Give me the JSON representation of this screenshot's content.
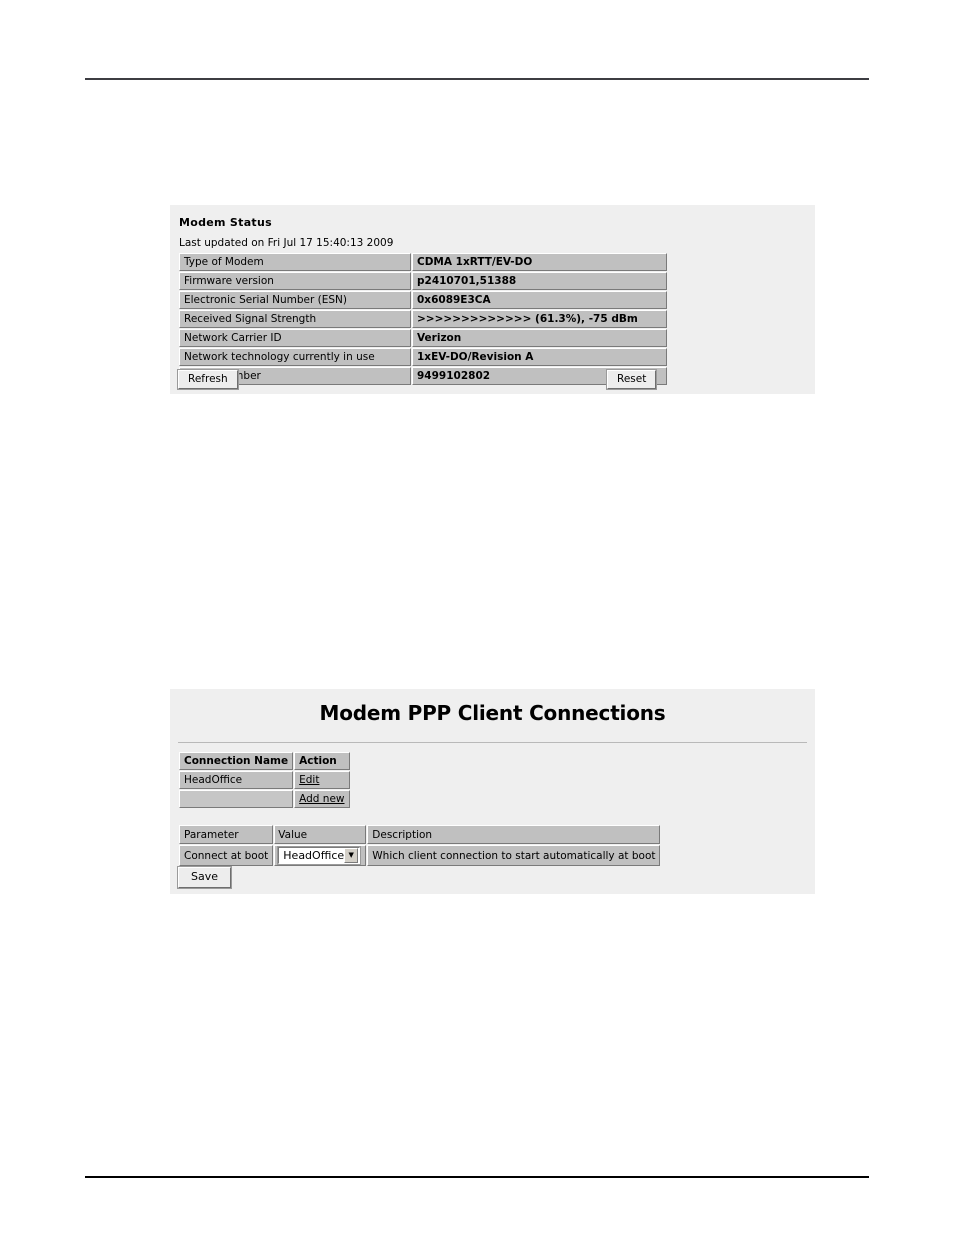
{
  "page": {
    "background": "#ffffff",
    "panel_background": "#efefef",
    "table_cell_background": "#c0c0c0",
    "rule_color": "#3d3d42"
  },
  "modem_status": {
    "heading": "Modem Status",
    "last_updated": "Last updated on Fri Jul 17 15:40:13 2009",
    "rows": [
      {
        "label": "Type of Modem",
        "value": "CDMA 1xRTT/EV-DO"
      },
      {
        "label": "Firmware version",
        "value": "p2410701,51388"
      },
      {
        "label": "Electronic Serial Number (ESN)",
        "value": "0x6089E3CA"
      },
      {
        "label": "Received Signal Strength",
        "value": ">>>>>>>>>>>>> (61.3%), -75 dBm"
      },
      {
        "label": "Network Carrier ID",
        "value": "Verizon"
      },
      {
        "label": "Network technology currently in use",
        "value": "1xEV-DO/Revision A"
      },
      {
        "label": "Phone number",
        "value": "9499102802"
      }
    ],
    "refresh_label": "Refresh",
    "reset_label": "Reset"
  },
  "ppp": {
    "title": "Modem PPP Client Connections",
    "connections_table": {
      "headers": [
        "Connection Name",
        "Action"
      ],
      "rows": [
        {
          "name": "HeadOffice",
          "action": "Edit"
        },
        {
          "name": "",
          "action": "Add new"
        }
      ]
    },
    "parameter_table": {
      "headers": [
        "Parameter",
        "Value",
        "Description"
      ],
      "rows": [
        {
          "parameter": "Connect at boot",
          "value": "HeadOffice",
          "value_options": [
            "HeadOffice"
          ],
          "description": "Which client connection to start automatically at boot"
        }
      ]
    },
    "save_label": "Save",
    "dropdown_arrow": "▼"
  }
}
